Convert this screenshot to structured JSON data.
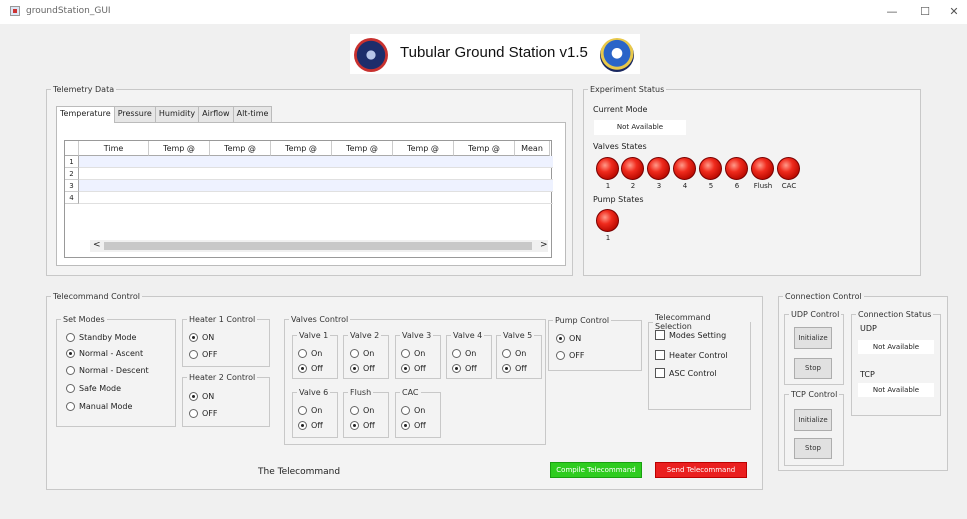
{
  "window": {
    "title": "groundStation_GUI",
    "minimize": "—",
    "maximize": "☐",
    "close": "✕"
  },
  "header": {
    "title": "Tubular Ground Station v1.5"
  },
  "telemetry": {
    "legend": "Telemetry Data",
    "tabs": [
      "Temperature",
      "Pressure",
      "Humidity",
      "Airflow",
      "Alt-time"
    ],
    "columns": [
      "Time",
      "Temp @",
      "Temp @",
      "Temp @",
      "Temp @",
      "Temp @",
      "Temp @",
      "Mean"
    ],
    "rows": [
      "1",
      "2",
      "3",
      "4"
    ],
    "scroll_left": "<",
    "scroll_right": ">"
  },
  "experiment": {
    "legend": "Experiment Status",
    "current_mode_label": "Current Mode",
    "current_mode_value": "Not Available",
    "valves_label": "Valves States",
    "valves": [
      "1",
      "2",
      "3",
      "4",
      "5",
      "6",
      "Flush",
      "CAC"
    ],
    "pump_label": "Pump States",
    "pumps": [
      "1"
    ]
  },
  "telecommand": {
    "legend": "Telecommand Control",
    "set_modes": {
      "legend": "Set Modes",
      "options": [
        "Standby Mode",
        "Normal - Ascent",
        "Normal - Descent",
        "Safe Mode",
        "Manual Mode"
      ],
      "selected": 1
    },
    "heater1": {
      "legend": "Heater 1 Control",
      "on": "ON",
      "off": "OFF"
    },
    "heater2": {
      "legend": "Heater 2 Control",
      "on": "ON",
      "off": "OFF"
    },
    "valves_control": {
      "legend": "Valves Control",
      "groups": [
        {
          "name": "Valve 1",
          "on": "On",
          "off": "Off"
        },
        {
          "name": "Valve 2",
          "on": "On",
          "off": "Off"
        },
        {
          "name": "Valve 3",
          "on": "On",
          "off": "Off"
        },
        {
          "name": "Valve 4",
          "on": "On",
          "off": "Off"
        },
        {
          "name": "Valve 5",
          "on": "On",
          "off": "Off"
        },
        {
          "name": "Valve 6",
          "on": "On",
          "off": "Off"
        },
        {
          "name": "Flush",
          "on": "On",
          "off": "Off"
        },
        {
          "name": "CAC",
          "on": "On",
          "off": "Off"
        }
      ]
    },
    "pump_control": {
      "legend": "Pump Control",
      "on": "ON",
      "off": "OFF"
    },
    "selection": {
      "legend": "Telecommand Selection",
      "items": [
        "Modes Setting",
        "Heater Control",
        "ASC Control"
      ]
    },
    "the_telecommand": "The Telecommand",
    "compile_button": "Compile Telecommand",
    "send_button": "Send Telecommand",
    "compile_color": "#2ecc1f",
    "send_color": "#ea1f1f"
  },
  "connection": {
    "legend": "Connection Control",
    "udp_control": {
      "legend": "UDP Control",
      "initialize": "Initialize",
      "stop": "Stop"
    },
    "tcp_control": {
      "legend": "TCP Control",
      "initialize": "Initialize",
      "stop": "Stop"
    },
    "status": {
      "legend": "Connection Status",
      "udp_label": "UDP",
      "udp_value": "Not Available",
      "tcp_label": "TCP",
      "tcp_value": "Not Available"
    }
  }
}
